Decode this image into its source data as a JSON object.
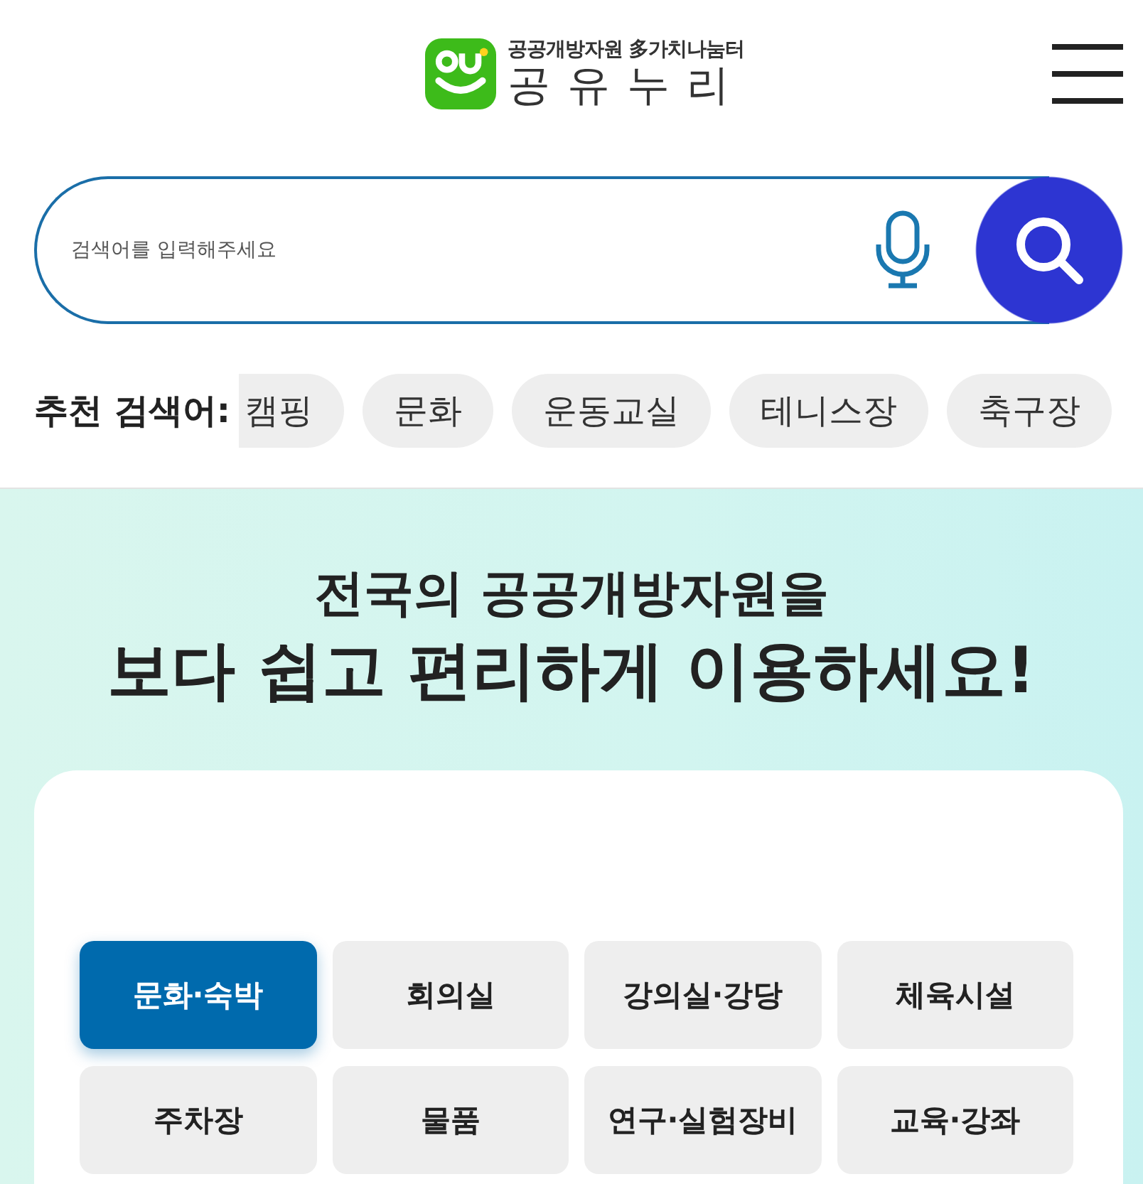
{
  "header": {
    "logo": {
      "tagline": "공공개방자원 多가치나눔터",
      "name": "공유누리"
    }
  },
  "search": {
    "placeholder": "검색어를 입력해주세요"
  },
  "recommended": {
    "label": "추천 검색어:",
    "keywords": [
      "캠핑",
      "문화",
      "운동교실",
      "테니스장",
      "축구장"
    ]
  },
  "hero": {
    "line_1": "전국의 공공개방자원을",
    "line_2": "보다 쉽고 편리하게 이용하세요!"
  },
  "categories": [
    {
      "label": "문화·숙박",
      "selected": true
    },
    {
      "label": "회의실",
      "selected": false
    },
    {
      "label": "강의실·강당",
      "selected": false
    },
    {
      "label": "체육시설",
      "selected": false
    },
    {
      "label": "주차장",
      "selected": false
    },
    {
      "label": "물품",
      "selected": false
    },
    {
      "label": "연구·실험장비",
      "selected": false
    },
    {
      "label": "교육·강좌",
      "selected": false
    }
  ]
}
